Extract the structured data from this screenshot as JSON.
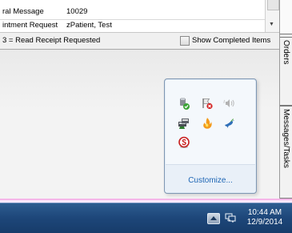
{
  "message_list": {
    "rows": [
      {
        "type": "ral Message",
        "value": "10029"
      },
      {
        "type": "intment Request",
        "value": "zPatient, Test"
      }
    ]
  },
  "legend": {
    "text": "3 = Read Receipt Requested",
    "show_completed_label": "Show Completed Items",
    "show_completed_checked": false
  },
  "side_tabs": {
    "orders": "Orders",
    "messages": "Messages/Tasks"
  },
  "tray_popup": {
    "icons": [
      "usb-safely-remove-icon",
      "flag-error-icon",
      "volume-icon",
      "network-drive-icon",
      "flame-app-icon",
      "bird-app-icon",
      "red-s-app-icon"
    ],
    "customize_label": "Customize..."
  },
  "taskbar": {
    "time": "10:44 AM",
    "date": "12/9/2014"
  },
  "colors": {
    "taskbar": "#1d4679",
    "link": "#1e66b5",
    "pink_bar": "#f5b6e8"
  }
}
